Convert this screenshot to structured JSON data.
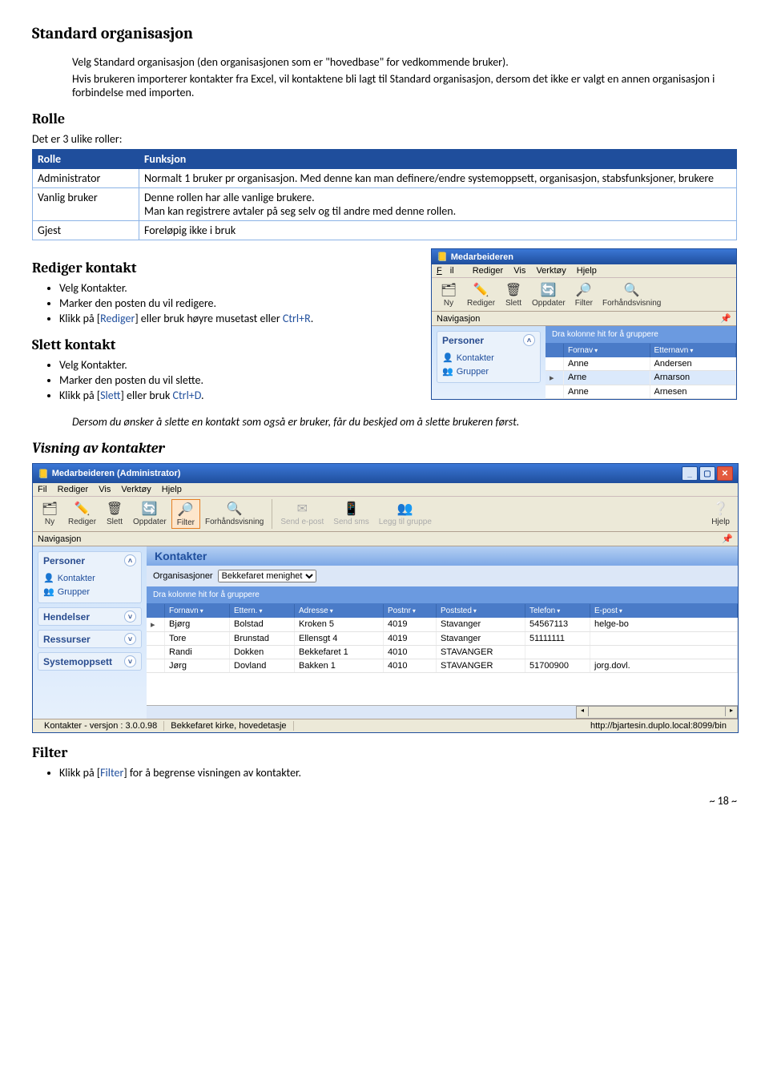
{
  "headings": {
    "h1": "Standard organisasjon",
    "intro1": "Velg Standard organisasjon (den organisasjonen som er \"hovedbase\" for vedkommende bruker).",
    "intro2": "Hvis brukeren importerer kontakter fra Excel, vil kontaktene bli lagt til Standard organisasjon, dersom det ikke er valgt en annen organisasjon i forbindelse med importen.",
    "rolle": "Rolle",
    "roller_intro": "Det er 3 ulike roller:",
    "h2_rediger": "Rediger kontakt",
    "h2_slett": "Slett kontakt",
    "h3_visning": "Visning av kontakter",
    "filter": "Filter"
  },
  "roletable": {
    "th_rolle": "Rolle",
    "th_funksjon": "Funksjon",
    "rows": [
      {
        "rolle": "Administrator",
        "desc": "Normalt 1 bruker pr organisasjon. Med denne kan man definere/endre systemoppsett, organisasjon, stabsfunksjoner, brukere"
      },
      {
        "rolle": "Vanlig bruker",
        "desc": "Denne rollen har alle vanlige brukere.\nMan kan registrere avtaler på seg selv og til andre med denne rollen."
      },
      {
        "rolle": "Gjest",
        "desc": "Foreløpig ikke i bruk"
      }
    ]
  },
  "rediger": {
    "i1": "Velg Kontakter.",
    "i2": "Marker den posten du vil redigere.",
    "i3a": "Klikk på [",
    "i3b": "Rediger",
    "i3c": "] eller bruk høyre musetast eller ",
    "i3d": "Ctrl+R",
    "i3e": "."
  },
  "slett": {
    "i1": "Velg Kontakter.",
    "i2": "Marker den posten du vil slette.",
    "i3a": "Klikk på [",
    "i3b": "Slett",
    "i3c": "] eller bruk ",
    "i3d": "Ctrl+D",
    "i3e": ".",
    "note": "Dersom du ønsker å slette en kontakt som også er bruker, får du beskjed om å slette brukeren først."
  },
  "filterbul": {
    "a": "Klikk på [",
    "b": "Filter",
    "c": "] for å begrense visningen av kontakter."
  },
  "pagefoot": "~ 18 ~",
  "smallwin": {
    "title": "Medarbeideren",
    "menu": {
      "fil": "Fil",
      "rediger": "Rediger",
      "vis": "Vis",
      "verktoy": "Verktøy",
      "hjelp": "Hjelp"
    },
    "tools": {
      "ny": "Ny",
      "rediger": "Rediger",
      "slett": "Slett",
      "oppdater": "Oppdater",
      "filter": "Filter",
      "forhands": "Forhåndsvisning"
    },
    "nav": "Navigasjon",
    "personer": "Personer",
    "kontakter": "Kontakter",
    "grupper": "Grupper",
    "groupbar": "Dra kolonne hit for å gruppere",
    "cols": {
      "fornavn": "Fornav",
      "etternavn": "Etternavn"
    },
    "rows": [
      {
        "f": "Anne",
        "e": "Andersen"
      },
      {
        "f": "Arne",
        "e": "Arnarson"
      },
      {
        "f": "Anne",
        "e": "Arnesen"
      }
    ]
  },
  "bigwin": {
    "title": "Medarbeideren (Administrator)",
    "menu": {
      "fil": "Fil",
      "rediger": "Rediger",
      "vis": "Vis",
      "verktoy": "Verktøy",
      "hjelp": "Hjelp"
    },
    "tools": {
      "ny": "Ny",
      "rediger": "Rediger",
      "slett": "Slett",
      "oppdater": "Oppdater",
      "filter": "Filter",
      "forhands": "Forhåndsvisning",
      "epost": "Send e-post",
      "sms": "Send sms",
      "gruppe": "Legg til gruppe",
      "hjelp": "Hjelp"
    },
    "nav": "Navigasjon",
    "side": {
      "personer": "Personer",
      "kontakter": "Kontakter",
      "grupper": "Grupper",
      "hendelser": "Hendelser",
      "ressurser": "Ressurser",
      "system": "Systemoppsett"
    },
    "tabhdr": "Kontakter",
    "orglabel": "Organisasjoner",
    "orgvalue": "Bekkefaret menighet",
    "groupbar": "Dra kolonne hit for å gruppere",
    "cols": {
      "fornavn": "Fornavn",
      "ettern": "Ettern.",
      "adresse": "Adresse",
      "postnr": "Postnr",
      "poststed": "Poststed",
      "telefon": "Telefon",
      "epost": "E-post"
    },
    "rows": [
      {
        "f": "Bjørg",
        "e": "Bolstad",
        "a": "Kroken 5",
        "p": "4019",
        "s": "Stavanger",
        "t": "54567113",
        "m": "helge-bo"
      },
      {
        "f": "Tore",
        "e": "Brunstad",
        "a": "Ellensgt 4",
        "p": "4019",
        "s": "Stavanger",
        "t": "51111111",
        "m": ""
      },
      {
        "f": "Randi",
        "e": "Dokken",
        "a": "Bekkefaret 1",
        "p": "4010",
        "s": "STAVANGER",
        "t": "",
        "m": ""
      },
      {
        "f": "Jørg",
        "e": "Dovland",
        "a": "Bakken 1",
        "p": "4010",
        "s": "STAVANGER",
        "t": "51700900",
        "m": "jorg.dovl."
      }
    ],
    "status": {
      "ver": "Kontakter - versjon : 3.0.0.98",
      "org": "Bekkefaret kirke, hovedetasje",
      "url": "http://bjartesin.duplo.local:8099/bin"
    }
  }
}
